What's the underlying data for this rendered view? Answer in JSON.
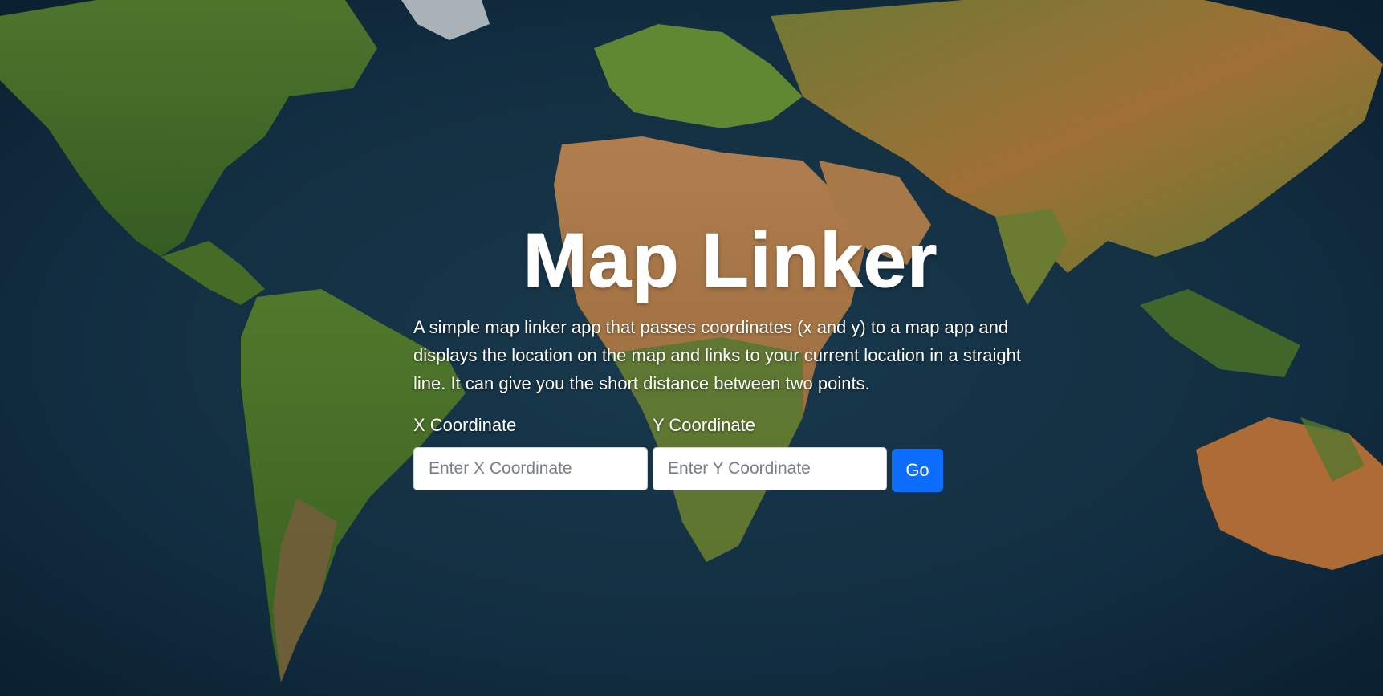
{
  "hero": {
    "title": "Map Linker",
    "description": "A simple map linker app that passes coordinates (x and y) to a map app and displays the location on the map and links to your current location in a straight line. It can give you the short distance between two points."
  },
  "form": {
    "x_label": "X Coordinate",
    "x_placeholder": "Enter X Coordinate",
    "x_value": "",
    "y_label": "Y Coordinate",
    "y_placeholder": "Enter Y Coordinate",
    "y_value": "",
    "go_label": "Go"
  },
  "colors": {
    "button": "#0d6efd",
    "text": "#ffffff"
  }
}
